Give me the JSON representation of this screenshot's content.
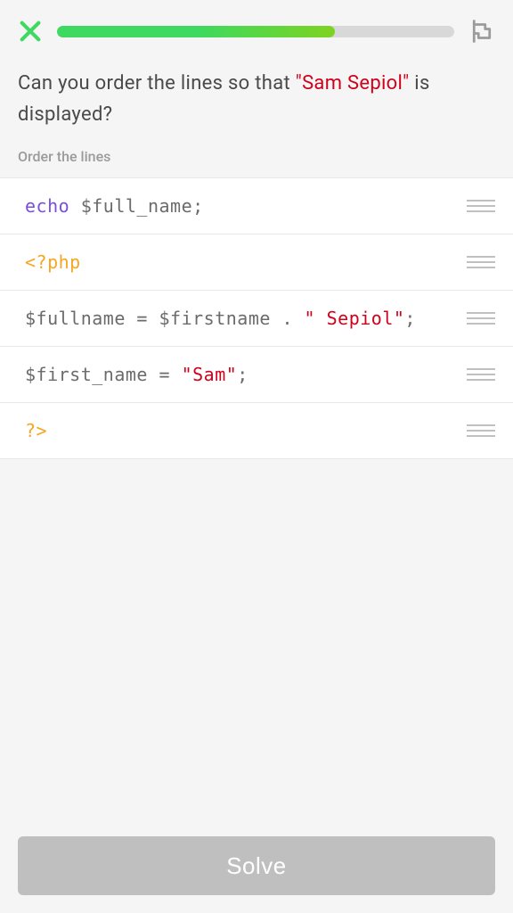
{
  "progress": {
    "percent": 70
  },
  "question": {
    "prefix": "Can you order the lines so that ",
    "highlight": "\"Sam Sepiol\"",
    "suffix": " is displayed?"
  },
  "instruction": "Order the lines",
  "code_lines": [
    {
      "tokens": [
        {
          "text": " echo ",
          "class": "tok-keyword"
        },
        {
          "text": "$full_name;",
          "class": "tok-variable"
        }
      ]
    },
    {
      "tokens": [
        {
          "text": "<?php",
          "class": "tok-php"
        }
      ]
    },
    {
      "tokens": [
        {
          "text": " $fullname = $firstname . ",
          "class": "tok-default"
        },
        {
          "text": "\" Sepiol\"",
          "class": "tok-string"
        },
        {
          "text": ";",
          "class": "tok-default"
        }
      ]
    },
    {
      "tokens": [
        {
          "text": " $first_name = ",
          "class": "tok-default"
        },
        {
          "text": "\"Sam\"",
          "class": "tok-string"
        },
        {
          "text": ";",
          "class": "tok-default"
        }
      ]
    },
    {
      "tokens": [
        {
          "text": "?>",
          "class": "tok-php"
        }
      ]
    }
  ],
  "solve_button_label": "Solve"
}
